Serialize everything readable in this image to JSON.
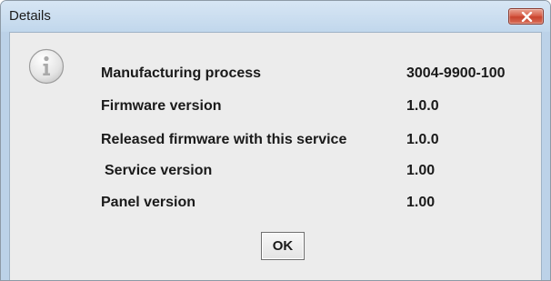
{
  "window": {
    "title": "Details"
  },
  "icons": {
    "close": "close-icon",
    "info": "info-icon"
  },
  "details": [
    {
      "label": "Manufacturing process",
      "value": "3004-9900-100"
    },
    {
      "label": "Firmware version",
      "value": "1.0.0"
    },
    {
      "label": "Released firmware with this service",
      "value": "1.0.0"
    },
    {
      "label": "Service version",
      "value": "1.00"
    },
    {
      "label": "Panel version",
      "value": "1.00"
    }
  ],
  "buttons": {
    "ok_label": "OK"
  },
  "colors": {
    "close_button": "#d8604a",
    "client_background": "#ececec",
    "title_bar": "#c8dcef"
  }
}
